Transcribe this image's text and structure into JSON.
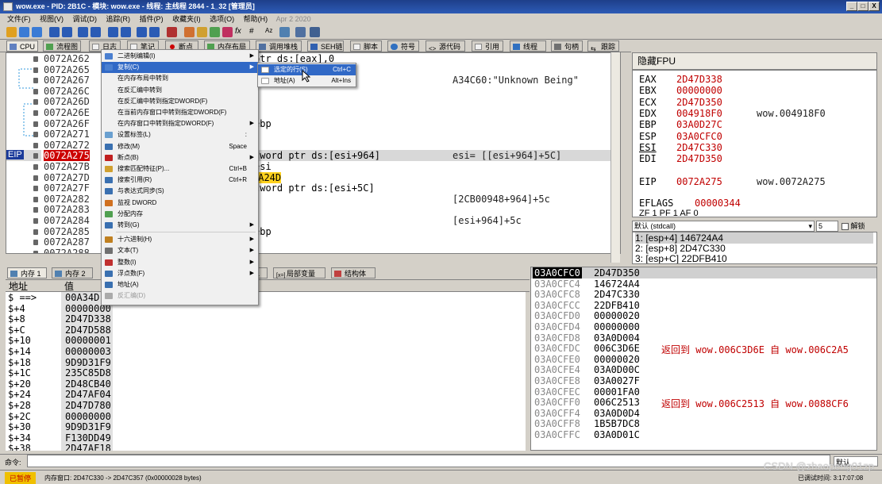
{
  "window": {
    "title": "wow.exe - PID: 2B1C - 模块: wow.exe - 线程: 主线程 2844 - 1_32 [管理员]",
    "min": "_",
    "max": "□",
    "close": "X"
  },
  "menu": {
    "items": [
      "文件(F)",
      "视图(V)",
      "调试(D)",
      "追踪(R)",
      "插件(P)",
      "收藏夹(I)",
      "选项(O)",
      "帮助(H)"
    ],
    "date": "Apr 2 2020"
  },
  "panel_tabs": [
    "CPU",
    "流程图",
    "日志",
    "笔记",
    "断点",
    "内存布局",
    "调用堆栈",
    "SEH链",
    "脚本",
    "符号",
    "源代码",
    "引用",
    "线程",
    "句柄",
    "跟踪"
  ],
  "cpu": {
    "eip_label": "EIP",
    "addresses": [
      "0072A262",
      "0072A265",
      "0072A267",
      "0072A26C",
      "0072A26D",
      "0072A26E",
      "0072A26F",
      "0072A271",
      "0072A272",
      "0072A275",
      "0072A27B",
      "0072A27D",
      "0072A27F",
      "0072A282",
      "0072A283",
      "0072A284",
      "0072A285",
      "0072A287",
      "0072A288"
    ],
    "code_lines": [
      {
        "row": 0,
        "text": "ptr ds:[eax],0"
      },
      {
        "row": 6,
        "text": "ebp"
      },
      {
        "row": 9,
        "text": "dword ptr ds:[esi+964]"
      },
      {
        "row": 10,
        "text": "esi"
      },
      {
        "row": 11,
        "text": "2A24D"
      },
      {
        "row": 12,
        "text": "dword ptr ds:[esi+5C]"
      },
      {
        "row": 16,
        "text": "ebp"
      }
    ],
    "comments": [
      {
        "row": 2,
        "text": "A34C60:\"Unknown Being\""
      },
      {
        "row": 9,
        "text": "esi= [[esi+964]+5C]"
      },
      {
        "row": 13,
        "text": "[2CB00948+964]+5c"
      },
      {
        "row": 15,
        "text": "[esi+964]+5c"
      }
    ]
  },
  "context_menu": {
    "items": [
      {
        "label": "二进制编辑(I)",
        "key": "",
        "arrow": "▶"
      },
      {
        "label": "复制(C)",
        "key": "",
        "arrow": "▶",
        "highlight": true
      },
      {
        "label": "在内存布局中转到",
        "key": "",
        "arrow": ""
      },
      {
        "label": "在反汇编中转到",
        "key": "",
        "arrow": ""
      },
      {
        "label": "在反汇编中转到指定DWORD(F)",
        "key": "",
        "arrow": ""
      },
      {
        "label": "在当前内存窗口中转到指定DWORD(F)",
        "key": "",
        "arrow": ""
      },
      {
        "label": "在内存窗口中转到指定DWORD(F)",
        "key": "",
        "arrow": "▶"
      },
      {
        "label": "设置标签(L)",
        "key": ":",
        "arrow": ""
      },
      {
        "label": "修改(M)",
        "key": "Space",
        "arrow": ""
      },
      {
        "label": "断点(B)",
        "key": "",
        "arrow": "▶"
      },
      {
        "label": "搜索匹配特征(P)...",
        "key": "Ctrl+B",
        "arrow": ""
      },
      {
        "label": "搜索引用(R)",
        "key": "Ctrl+R",
        "arrow": ""
      },
      {
        "label": "与表达式同步(S)",
        "key": "",
        "arrow": ""
      },
      {
        "label": "监视 DWORD",
        "key": "",
        "arrow": ""
      },
      {
        "label": "分配内存",
        "key": "",
        "arrow": ""
      },
      {
        "label": "转到(G)",
        "key": "",
        "arrow": "▶"
      },
      {
        "label": "十六进制(H)",
        "key": "",
        "arrow": "▶"
      },
      {
        "label": "文本(T)",
        "key": "",
        "arrow": "▶"
      },
      {
        "label": "整数(I)",
        "key": "",
        "arrow": "▶"
      },
      {
        "label": "浮点数(F)",
        "key": "",
        "arrow": "▶"
      },
      {
        "label": "地址(A)",
        "key": "",
        "arrow": ""
      },
      {
        "label": "反汇编(D)",
        "key": "",
        "arrow": "",
        "disabled": true
      }
    ],
    "submenu": [
      {
        "label": "选定的行(S)",
        "key": "Ctrl+C"
      },
      {
        "label": "地址(A)",
        "key": "Alt+Ins"
      }
    ]
  },
  "registers": {
    "header": "隐藏FPU",
    "rows": [
      {
        "name": "EAX",
        "value": "2D47D338",
        "cmt": ""
      },
      {
        "name": "EBX",
        "value": "00000000",
        "cmt": ""
      },
      {
        "name": "ECX",
        "value": "2D47D350",
        "cmt": ""
      },
      {
        "name": "EDX",
        "value": "004918F0",
        "cmt": "wow.004918F0"
      },
      {
        "name": "EBP",
        "value": "03A0D27C",
        "cmt": ""
      },
      {
        "name": "ESP",
        "value": "03A0CFC0",
        "cmt": ""
      },
      {
        "name": "ESI",
        "value": "2D47C330",
        "cmt": ""
      },
      {
        "name": "EDI",
        "value": "2D47D350",
        "cmt": ""
      },
      {
        "name": "EIP",
        "value": "0072A275",
        "cmt": "wow.0072A275"
      },
      {
        "name": "EFLAGS",
        "value": "00000344",
        "cmt": ""
      }
    ],
    "flags": "ZF 1  PF 1  AF 0"
  },
  "call": {
    "convention": "默认 (stdcall)",
    "argcount": "5",
    "unlock": "解锁"
  },
  "args": [
    "1: [esp+4] 146724A4",
    "2: [esp+8] 2D47C330",
    "3: [esp+C] 22DFB410"
  ],
  "lower_tabs": [
    "内存 1",
    "内存 2",
    "局部变量",
    "结构体"
  ],
  "lower_tab_extra": "1",
  "memory": {
    "headers": [
      "地址",
      "值"
    ],
    "rows": [
      [
        "$ ==>",
        "00A34D"
      ],
      [
        "$+4",
        "00000000"
      ],
      [
        "$+8",
        "2D47D338"
      ],
      [
        "$+C",
        "2D47D588"
      ],
      [
        "$+10",
        "00000001"
      ],
      [
        "$+14",
        "00000003"
      ],
      [
        "$+18",
        "9D9D31F9"
      ],
      [
        "$+1C",
        "235C85D8"
      ],
      [
        "$+20",
        "2D48CB40"
      ],
      [
        "$+24",
        "2D47AF04"
      ],
      [
        "$+28",
        "2D47D780"
      ],
      [
        "$+2C",
        "00000000"
      ],
      [
        "$+30",
        "9D9D31F9"
      ],
      [
        "$+34",
        "F130DD49"
      ],
      [
        "$+38",
        "2D47AF18"
      ]
    ]
  },
  "stack": {
    "rows": [
      {
        "a": "03A0CFC0",
        "v": "2D47D350",
        "c": "",
        "sel": true
      },
      {
        "a": "03A0CFC4",
        "v": "146724A4",
        "c": ""
      },
      {
        "a": "03A0CFC8",
        "v": "2D47C330",
        "c": ""
      },
      {
        "a": "03A0CFCC",
        "v": "22DFB410",
        "c": ""
      },
      {
        "a": "03A0CFD0",
        "v": "00000020",
        "c": ""
      },
      {
        "a": "03A0CFD4",
        "v": "00000000",
        "c": ""
      },
      {
        "a": "03A0CFD8",
        "v": "03A0D004",
        "c": ""
      },
      {
        "a": "03A0CFDC",
        "v": "006C3D6E",
        "c": "返回到 wow.006C3D6E 自 wow.006C2A5"
      },
      {
        "a": "03A0CFE0",
        "v": "00000020",
        "c": ""
      },
      {
        "a": "03A0CFE4",
        "v": "03A0D00C",
        "c": ""
      },
      {
        "a": "03A0CFE8",
        "v": "03A0027F",
        "c": ""
      },
      {
        "a": "03A0CFEC",
        "v": "00001FA0",
        "c": ""
      },
      {
        "a": "03A0CFF0",
        "v": "006C2513",
        "c": "返回到 wow.006C2513 自 wow.0088CF6"
      },
      {
        "a": "03A0CFF4",
        "v": "03A0D0D4",
        "c": ""
      },
      {
        "a": "03A0CFF8",
        "v": "1B5B7DC8",
        "c": ""
      },
      {
        "a": "03A0CFFC",
        "v": "03A0D01C",
        "c": ""
      }
    ]
  },
  "command": {
    "label": "命令:",
    "mode": "默认"
  },
  "status": {
    "state": "已暂停",
    "text": "内存窗口: 2D47C330 -> 2D47C357 (0x00000028 bytes)",
    "time": "已调试时间: 3:17:07:08"
  },
  "watermark": "CSDN @zhaopeng01zp",
  "colors": {
    "accent": "#3169c6",
    "eip": "#cc0000",
    "title": "#1e3f8a"
  }
}
